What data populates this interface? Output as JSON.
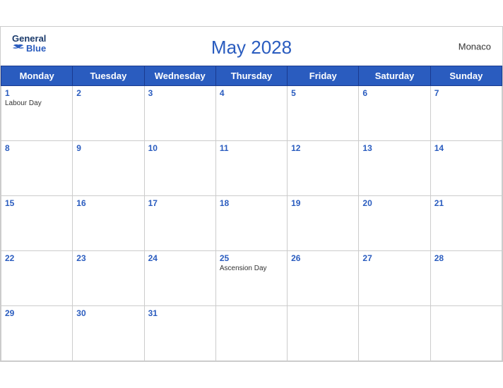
{
  "header": {
    "logo_general": "General",
    "logo_blue": "Blue",
    "title": "May 2028",
    "region": "Monaco"
  },
  "days_of_week": [
    "Monday",
    "Tuesday",
    "Wednesday",
    "Thursday",
    "Friday",
    "Saturday",
    "Sunday"
  ],
  "weeks": [
    [
      {
        "day": "1",
        "holiday": "Labour Day"
      },
      {
        "day": "2",
        "holiday": ""
      },
      {
        "day": "3",
        "holiday": ""
      },
      {
        "day": "4",
        "holiday": ""
      },
      {
        "day": "5",
        "holiday": ""
      },
      {
        "day": "6",
        "holiday": ""
      },
      {
        "day": "7",
        "holiday": ""
      }
    ],
    [
      {
        "day": "8",
        "holiday": ""
      },
      {
        "day": "9",
        "holiday": ""
      },
      {
        "day": "10",
        "holiday": ""
      },
      {
        "day": "11",
        "holiday": ""
      },
      {
        "day": "12",
        "holiday": ""
      },
      {
        "day": "13",
        "holiday": ""
      },
      {
        "day": "14",
        "holiday": ""
      }
    ],
    [
      {
        "day": "15",
        "holiday": ""
      },
      {
        "day": "16",
        "holiday": ""
      },
      {
        "day": "17",
        "holiday": ""
      },
      {
        "day": "18",
        "holiday": ""
      },
      {
        "day": "19",
        "holiday": ""
      },
      {
        "day": "20",
        "holiday": ""
      },
      {
        "day": "21",
        "holiday": ""
      }
    ],
    [
      {
        "day": "22",
        "holiday": ""
      },
      {
        "day": "23",
        "holiday": ""
      },
      {
        "day": "24",
        "holiday": ""
      },
      {
        "day": "25",
        "holiday": "Ascension Day"
      },
      {
        "day": "26",
        "holiday": ""
      },
      {
        "day": "27",
        "holiday": ""
      },
      {
        "day": "28",
        "holiday": ""
      }
    ],
    [
      {
        "day": "29",
        "holiday": ""
      },
      {
        "day": "30",
        "holiday": ""
      },
      {
        "day": "31",
        "holiday": ""
      },
      {
        "day": "",
        "holiday": ""
      },
      {
        "day": "",
        "holiday": ""
      },
      {
        "day": "",
        "holiday": ""
      },
      {
        "day": "",
        "holiday": ""
      }
    ]
  ]
}
